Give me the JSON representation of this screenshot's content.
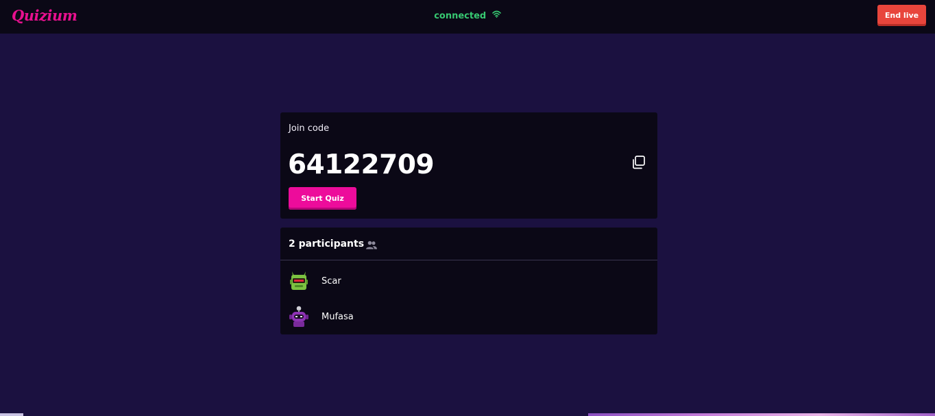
{
  "header": {
    "logo": "Quizium",
    "status": "connected",
    "end_live_label": "End live"
  },
  "join": {
    "label": "Join code",
    "code": "64122709",
    "start_label": "Start Quiz"
  },
  "participants": {
    "title": "2 participants",
    "list": [
      {
        "name": "Scar",
        "avatar": "green-robot-avatar"
      },
      {
        "name": "Mufasa",
        "avatar": "purple-robot-avatar"
      }
    ]
  },
  "colors": {
    "brand": "#e8108f",
    "background": "#1b1140",
    "panel": "#0b0816",
    "connected": "#37c871",
    "end_live": "#e8453c",
    "start_quiz": "#ed0c9b"
  }
}
